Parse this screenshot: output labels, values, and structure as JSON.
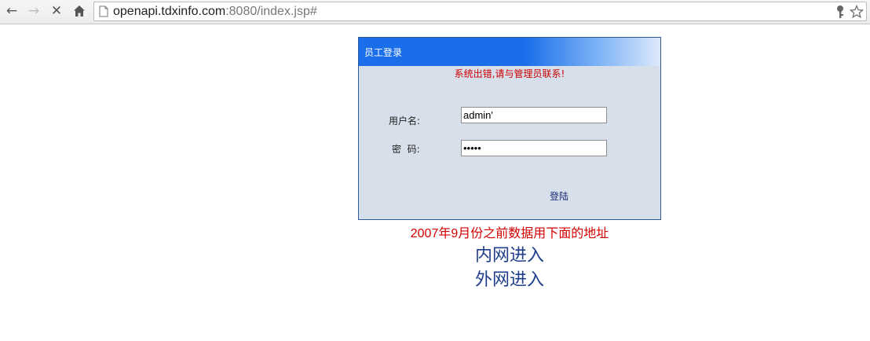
{
  "browser": {
    "url_host": "openapi.tdxinfo.com",
    "url_rest": ":8080/index.jsp#",
    "back_icon": "←",
    "forward_icon": "→",
    "stop_icon": "✕"
  },
  "login": {
    "title": "员工登录",
    "error": "系统出错,请与管理员联系!",
    "username_label": "用户名:",
    "username_value": "admin'",
    "password_label": "密  码:",
    "password_value": "admin",
    "submit_label": "登陆"
  },
  "notice": "2007年9月份之前数据用下面的地址",
  "links": {
    "intranet": "内网进入",
    "extranet": "外网进入"
  },
  "colors": {
    "error": "#cc0000",
    "link": "#1f3f8c",
    "panel_bg": "#d7dfeb",
    "header_blue": "#1a6eea"
  }
}
